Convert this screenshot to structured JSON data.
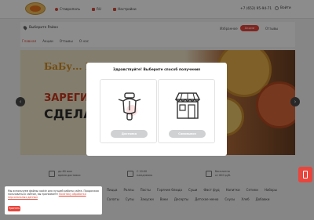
{
  "header": {
    "city": "Ставрополь",
    "lang": "RU",
    "settings": "Настройки",
    "phone": "+7 (652) 95-94-71",
    "login": "Войти"
  },
  "panel": {
    "address": "Выберите Район",
    "favorites": "Избранное",
    "promo": "Акции",
    "reviews": "Отзывы",
    "tabs": [
      "Главная",
      "Акции",
      "Отзывы",
      "О нас"
    ]
  },
  "banner": {
    "title": "БаБу... Гр...",
    "line1": "ЗАРЕГИС...",
    "line2": "СДЕЛА..."
  },
  "modal": {
    "title": "Здравствуйте! Выберите способ получения",
    "delivery_label": "Доставка",
    "pickup_label": "Самовывоз"
  },
  "info": [
    {
      "line1": "до 60 мин",
      "line2": "время доставки"
    },
    {
      "line1": "С 10:00",
      "line2": "ежедневно"
    },
    {
      "line1": "бесплатно",
      "line2": "от 600 руб."
    }
  ],
  "categories": [
    [
      "Пицца",
      "Роллы",
      "Пасты",
      "Горячие блюда",
      "Суши",
      "Фаст фуд",
      "Напитки",
      "Сетики",
      "Наборы"
    ],
    [
      "Салаты",
      "Супы",
      "Закуски",
      "Воки",
      "Десерты",
      "Детское меню",
      "Соусы",
      "Хлеб",
      "Добавки"
    ]
  ],
  "cookie": {
    "text": "Мы используем файлы cookie для лучшей работы сайта. Продолжая пользоваться сайтом, вы принимаете",
    "link": "Политику обработки персональных данных",
    "button": "Принять"
  }
}
